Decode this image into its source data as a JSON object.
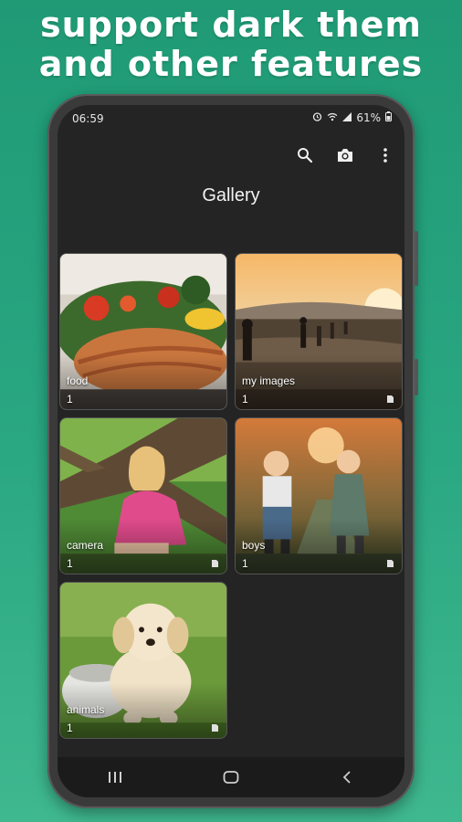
{
  "promo": {
    "line1": "support dark them",
    "line2": "and other features"
  },
  "status_bar": {
    "time": "06:59",
    "battery": "61%"
  },
  "toolbar": {
    "icons": [
      "search-icon",
      "camera-icon",
      "more-vert-icon"
    ]
  },
  "page": {
    "title": "Gallery"
  },
  "albums": [
    {
      "name": "food",
      "count": "1"
    },
    {
      "name": "my images",
      "count": "1"
    },
    {
      "name": "camera",
      "count": "1"
    },
    {
      "name": "boys",
      "count": "1"
    },
    {
      "name": "animals",
      "count": "1"
    }
  ],
  "nav": {
    "icons": [
      "recents-icon",
      "home-icon",
      "back-icon"
    ]
  },
  "colors": {
    "background": "#2aa882",
    "screen": "#242424",
    "navbar": "#1b1b1b"
  }
}
